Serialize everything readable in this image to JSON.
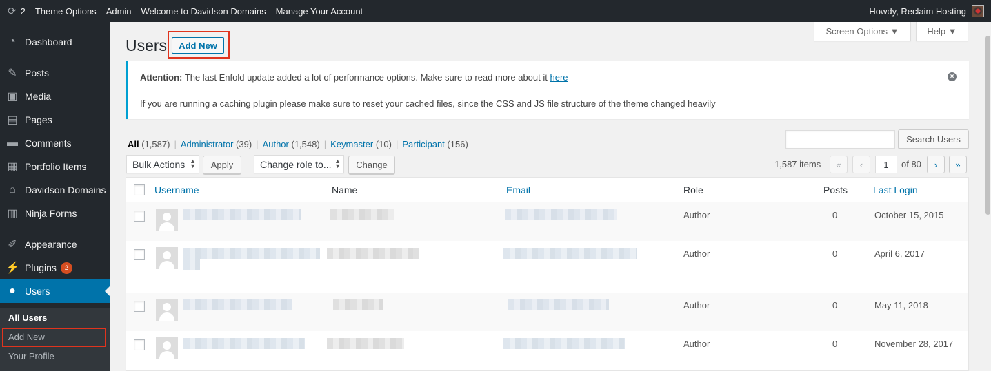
{
  "adminbar": {
    "updates_count": "2",
    "items": [
      "Theme Options",
      "Admin",
      "Welcome to Davidson Domains",
      "Manage Your Account"
    ],
    "greeting": "Howdy, Reclaim Hosting"
  },
  "sidebar": {
    "items": [
      {
        "label": "Dashboard",
        "icon": "dashboard-icon"
      },
      {
        "label": "Posts",
        "icon": "pin-icon"
      },
      {
        "label": "Media",
        "icon": "media-icon"
      },
      {
        "label": "Pages",
        "icon": "pages-icon"
      },
      {
        "label": "Comments",
        "icon": "comment-icon"
      },
      {
        "label": "Portfolio Items",
        "icon": "portfolio-icon"
      },
      {
        "label": "Davidson Domains",
        "icon": "home-icon"
      },
      {
        "label": "Ninja Forms",
        "icon": "forms-icon"
      },
      {
        "label": "Appearance",
        "icon": "brush-icon"
      },
      {
        "label": "Plugins",
        "icon": "plugin-icon",
        "badge": "2"
      },
      {
        "label": "Users",
        "icon": "user-icon"
      }
    ],
    "submenu": [
      "All Users",
      "Add New",
      "Your Profile"
    ]
  },
  "screen_options": "Screen Options ▼",
  "help": "Help ▼",
  "page_title": "Users",
  "add_new": "Add New",
  "notice": {
    "strong": "Attention:",
    "text1": "The last Enfold update added a lot of performance options. Make sure to read more about it",
    "link": "here",
    "text2": "If you are running a caching plugin please make sure to reset your cached files, since the CSS and JS file structure of the theme changed heavily"
  },
  "filters": [
    {
      "label": "All",
      "count": "(1,587)"
    },
    {
      "label": "Administrator",
      "count": "(39)"
    },
    {
      "label": "Author",
      "count": "(1,548)"
    },
    {
      "label": "Keymaster",
      "count": "(10)"
    },
    {
      "label": "Participant",
      "count": "(156)"
    }
  ],
  "search_button": "Search Users",
  "bulk_actions": "Bulk Actions",
  "apply": "Apply",
  "change_role": "Change role to...",
  "change": "Change",
  "items_count": "1,587 items",
  "pagination": {
    "first": "«",
    "prev": "‹",
    "current": "1",
    "of": "of 80",
    "next": "›",
    "last": "»"
  },
  "columns": [
    "Username",
    "Name",
    "Email",
    "Role",
    "Posts",
    "Last Login"
  ],
  "rows": [
    {
      "role": "Author",
      "posts": "0",
      "last_login": "October 15, 2015"
    },
    {
      "role": "Author",
      "posts": "0",
      "last_login": "April 6, 2017"
    },
    {
      "role": "Author",
      "posts": "0",
      "last_login": "May 11, 2018"
    },
    {
      "role": "Author",
      "posts": "0",
      "last_login": "November 28, 2017"
    }
  ]
}
